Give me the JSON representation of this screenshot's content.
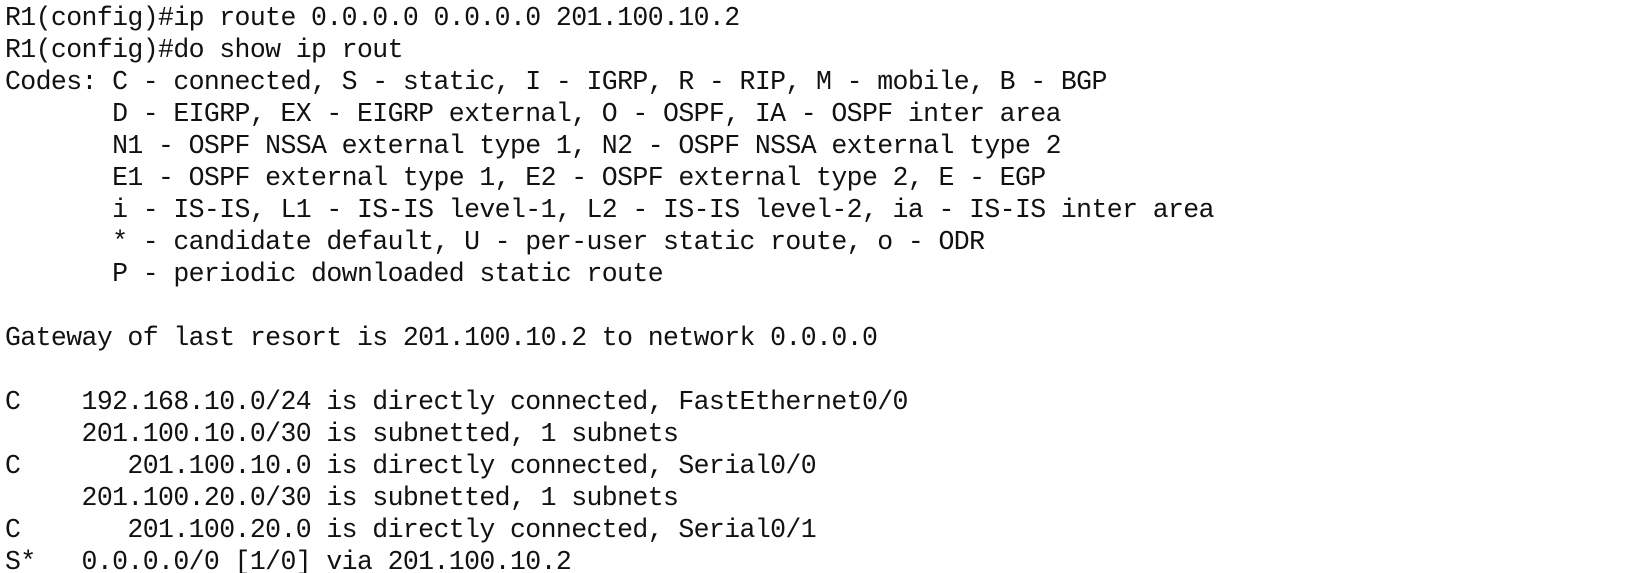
{
  "terminal": {
    "lines": [
      "R1(config)#ip route 0.0.0.0 0.0.0.0 201.100.10.2",
      "R1(config)#do show ip rout",
      "Codes: C - connected, S - static, I - IGRP, R - RIP, M - mobile, B - BGP",
      "       D - EIGRP, EX - EIGRP external, O - OSPF, IA - OSPF inter area",
      "       N1 - OSPF NSSA external type 1, N2 - OSPF NSSA external type 2",
      "       E1 - OSPF external type 1, E2 - OSPF external type 2, E - EGP",
      "       i - IS-IS, L1 - IS-IS level-1, L2 - IS-IS level-2, ia - IS-IS inter area",
      "       * - candidate default, U - per-user static route, o - ODR",
      "       P - periodic downloaded static route",
      "",
      "Gateway of last resort is 201.100.10.2 to network 0.0.0.0",
      "",
      "C    192.168.10.0/24 is directly connected, FastEthernet0/0",
      "     201.100.10.0/30 is subnetted, 1 subnets",
      "C       201.100.10.0 is directly connected, Serial0/0",
      "     201.100.20.0/30 is subnetted, 1 subnets",
      "C       201.100.20.0 is directly connected, Serial0/1",
      "S*   0.0.0.0/0 [1/0] via 201.100.10.2"
    ]
  }
}
